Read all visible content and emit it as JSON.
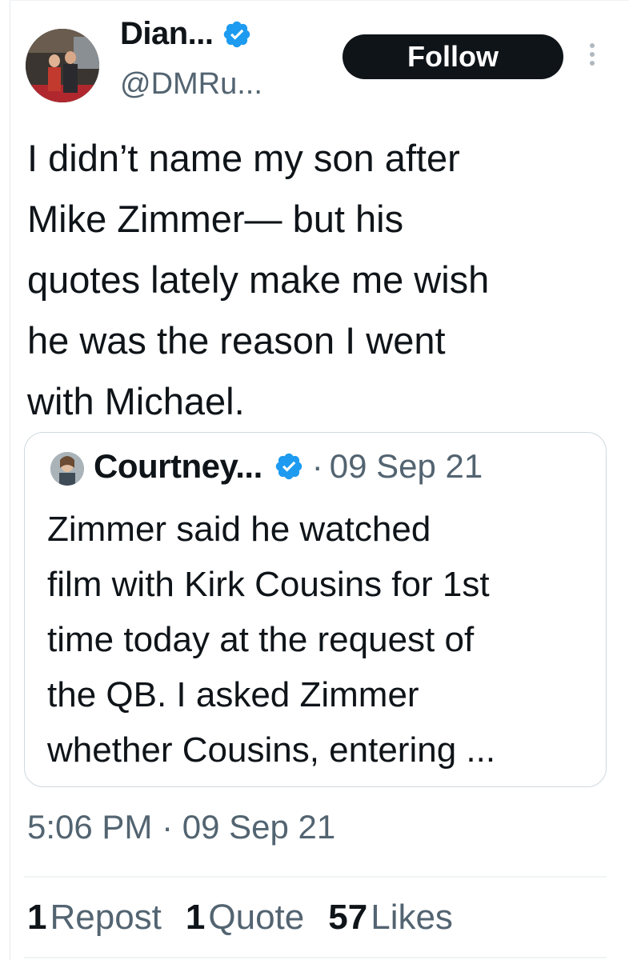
{
  "author": {
    "display_name": "Dian...",
    "handle": "@DMRu...",
    "verified": true
  },
  "follow_label": "Follow",
  "tweet_text": "I didn’t name my son after\nMike Zimmer— but his\nquotes lately make me wish\nhe was the reason I went\nwith Michael.",
  "quoted": {
    "display_name": "Courtney...",
    "verified": true,
    "separator": "·",
    "date": "09 Sep 21",
    "text": "Zimmer said he watched\nfilm with Kirk Cousins for 1st\ntime today at the request of\nthe QB. I asked Zimmer\nwhether Cousins, entering ..."
  },
  "timestamp": "5:06 PM · 09 Sep 21",
  "stats": [
    {
      "count": "1",
      "label": "Repost"
    },
    {
      "count": "1",
      "label": "Quote"
    },
    {
      "count": "57",
      "label": "Likes"
    }
  ],
  "colors": {
    "verified_blue": "#1d9bf0",
    "text_primary": "#0f1419",
    "text_secondary": "#536471",
    "border": "#cfd9de"
  },
  "icons": {
    "verified": "verified-badge-icon",
    "more": "more-vertical-icon"
  }
}
